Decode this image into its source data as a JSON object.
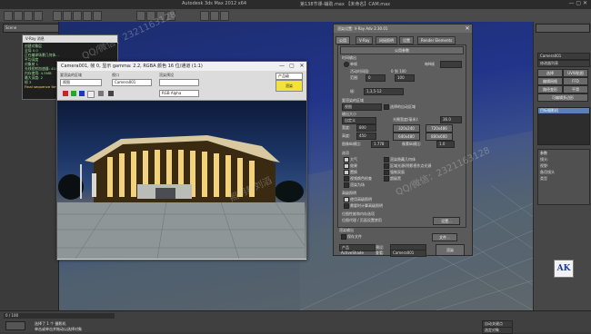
{
  "app": {
    "title": "Autodesk 3ds Max 2012 x64",
    "file": "第138节课-辅助.max 【未命名】CAM.max"
  },
  "log": {
    "header": "V-Ray 消息",
    "lines": [
      "创建对象层",
      "全局 0.0",
      "正在编译场景几何体...",
      "平均深度",
      "对象树 1",
      "光线投射加速器: 41000",
      "内存使用: 4.5MB",
      "最大深度: 2",
      "帧 3",
      "Final sequence time"
    ]
  },
  "frame_window": {
    "title": "Camera001, 帧 0, 显示 gamma: 2.2, RGBA 颜色 16 位/通道 (1:1)",
    "area_label": "要渲染的区域",
    "area_value": "视图",
    "viewport_label": "视口",
    "viewport_value": "Camera001",
    "preset_label": "渲染预设",
    "preset_value": "",
    "channel_value": "RGB Alpha",
    "render_label": "产品级",
    "render_button": "渲染"
  },
  "vray": {
    "title": "渲染设置: V-Ray Adv 2.30.01",
    "tabs": [
      "公用",
      "V-Ray",
      "间接照明",
      "设置",
      "Render Elements"
    ],
    "section_common": "公用参数",
    "time_output": "时间输出",
    "single": "单帧",
    "every_nth": "每N帧",
    "active_segment": "活动时间段:",
    "range_val": "0 到 100",
    "range_label": "范围:",
    "range_from": "0",
    "range_to": "100",
    "frames_label": "帧:",
    "frames_val": "1,3,5-12",
    "area_to_render": "要渲染的区域",
    "area_value": "视图",
    "auto_region": "选择的自动区域",
    "output_size": "输出大小",
    "custom": "自定义",
    "aperture": "光圈宽度(毫米):",
    "aperture_val": "36.0",
    "width_label": "宽度:",
    "width_val": "800",
    "height_label": "高度:",
    "height_val": "450",
    "sizes": [
      "320x240",
      "720x486",
      "640x480",
      "800x600"
    ],
    "aspect_label": "图像纵横比:",
    "aspect_val": "1.778",
    "pixel_aspect_label": "像素纵横比:",
    "pixel_aspect_val": "1.0",
    "options": "选项",
    "opt_atmos": "大气",
    "opt_effects": "效果",
    "opt_displace": "置换",
    "opt_video": "视频颜色检查",
    "opt_field": "渲染为场",
    "opt_hidden": "渲染隐藏几何体",
    "opt_area": "区域光源/阴影视作点光源",
    "opt_force2": "强制双面",
    "opt_super": "超级黑",
    "advanced_lighting": "高级照明",
    "use_adv": "使用高级照明",
    "compute_adv": "需要时计算高级照明",
    "bitmap_perf": "位图性能和内存选项",
    "bitmap_proxy": "位图代理 / 页面设置禁用",
    "setup_btn": "设置...",
    "render_output": "渲染输出",
    "save_file": "保存文件",
    "files_btn": "文件...",
    "product_label": "产品",
    "preset_label": "预设:",
    "viewport_label": "查看:",
    "viewport_val": "Camera001",
    "render_btn": "渲染",
    "activeshade": "ActiveShade"
  },
  "cmd_panel": {
    "object_name": "Camera001",
    "modifier_list": "修改器列表",
    "items": [
      "选择",
      "UVW贴图",
      "编辑网格",
      "FFD",
      "路径变形",
      "平滑",
      "可编辑多边形"
    ],
    "stack_item": "目标摄影机",
    "params": [
      "参数",
      "镜头:",
      "视野:",
      "备用镜头",
      "类型"
    ]
  },
  "status": {
    "selected": "选择了 1 个 摄影机",
    "hint": "单击或单击并拖动以选择对象",
    "time": "0 / 100",
    "frame_field": "自动关键点",
    "select_mode": "选定对象",
    "watermark1": "QQ/微信：2321163128",
    "watermark2": "照明邦刘滔"
  }
}
